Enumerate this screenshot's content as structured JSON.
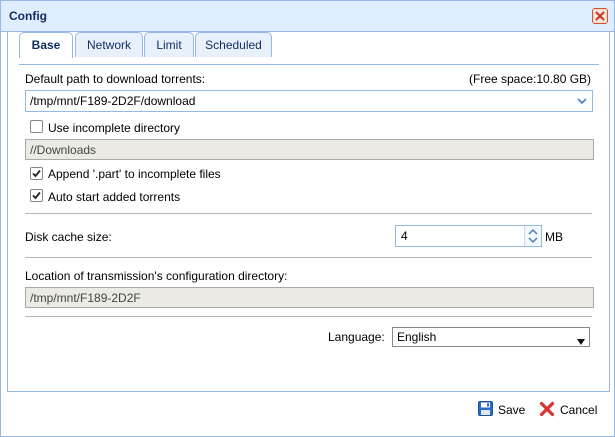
{
  "window": {
    "title": "Config"
  },
  "tabs": [
    {
      "label": "Base",
      "active": true
    },
    {
      "label": "Network",
      "active": false
    },
    {
      "label": "Limit",
      "active": false
    },
    {
      "label": "Scheduled",
      "active": false
    }
  ],
  "base": {
    "download_path_label": "Default path to download torrents:",
    "free_space": "(Free space:10.80 GB)",
    "download_path_value": "/tmp/mnt/F189-2D2F/download",
    "use_incomplete_label": "Use incomplete directory",
    "use_incomplete_checked": false,
    "incomplete_dir_value": "//Downloads",
    "append_part_label": "Append '.part' to incomplete files",
    "append_part_checked": true,
    "auto_start_label": "Auto start added torrents",
    "auto_start_checked": true,
    "disk_cache_label": "Disk cache size:",
    "disk_cache_value": "4",
    "disk_cache_unit": "MB",
    "config_dir_label": "Location of transmission's configuration directory:",
    "config_dir_value": "/tmp/mnt/F189-2D2F",
    "language_label": "Language:",
    "language_value": "English"
  },
  "footer": {
    "save_label": "Save",
    "cancel_label": "Cancel"
  },
  "colors": {
    "accent": "#95b8e7",
    "title_bg": "#e0ecff",
    "save_blue": "#2a6cc4",
    "cancel_red": "#d9322c"
  }
}
